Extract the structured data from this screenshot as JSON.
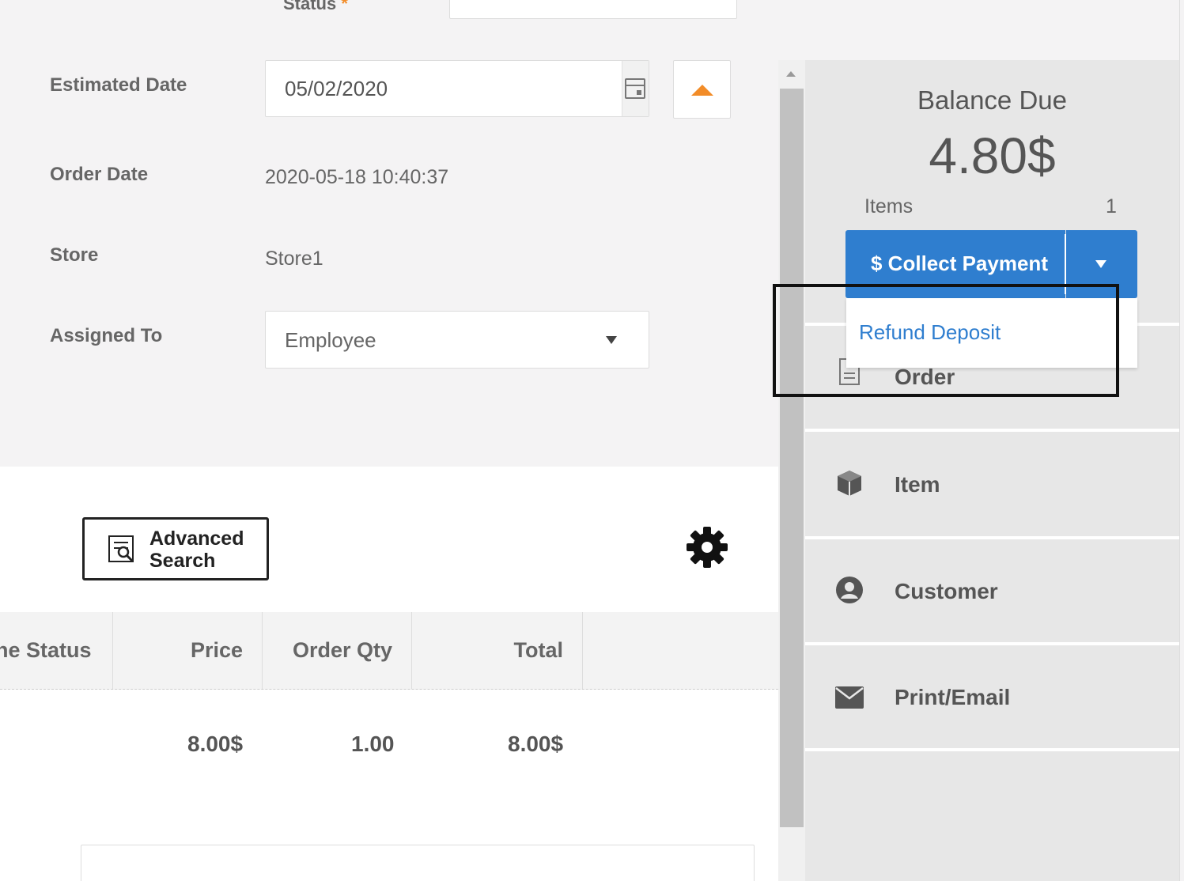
{
  "form": {
    "status_label": "Status",
    "status_required": "*",
    "estimated_date_label": "Estimated Date",
    "estimated_date_value": "05/02/2020",
    "order_date_label": "Order Date",
    "order_date_value": "2020-05-18 10:40:37",
    "store_label": "Store",
    "store_value": "Store1",
    "assigned_to_label": "Assigned To",
    "assigned_to_value": "Employee"
  },
  "toolbar": {
    "advanced_search_line1": "Advanced",
    "advanced_search_line2": "Search",
    "settings_icon": "gear-icon"
  },
  "table": {
    "columns": [
      "ne Status",
      "Price",
      "Order Qty",
      "Total"
    ],
    "rows": [
      {
        "price": "8.00$",
        "qty": "1.00",
        "total": "8.00$"
      }
    ]
  },
  "panel": {
    "balance_label": "Balance Due",
    "balance_value": "4.80$",
    "items_label": "Items",
    "items_count": "1",
    "collect_label": "$ Collect Payment",
    "dropdown_option": "Refund Deposit",
    "menu": [
      {
        "label": "Order",
        "icon": "document-icon"
      },
      {
        "label": "Item",
        "icon": "cube-icon"
      },
      {
        "label": "Customer",
        "icon": "user-circle-icon"
      },
      {
        "label": "Print/Email",
        "icon": "envelope-icon"
      }
    ]
  },
  "colors": {
    "accent_orange": "#f28c28",
    "primary_blue": "#2f7ecf",
    "panel_bg": "#e7e7e7"
  }
}
